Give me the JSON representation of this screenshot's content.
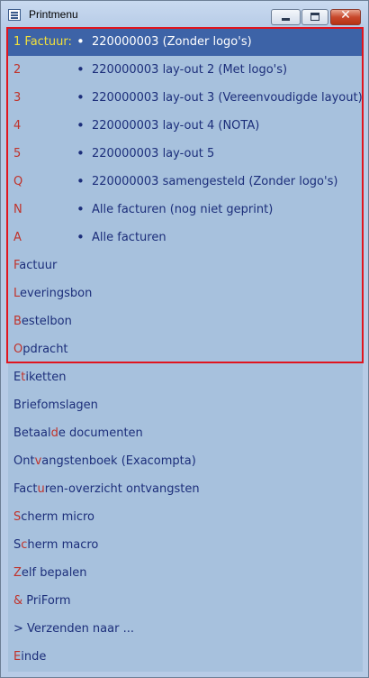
{
  "window": {
    "title": "Printmenu",
    "controls": {
      "minimize": "–",
      "maximize": "□",
      "close": "✕"
    }
  },
  "print_items": [
    {
      "key": "1",
      "key_suffix": " Factuur:",
      "bullet": "•",
      "text": "220000003 (Zonder logo's)",
      "selected": true
    },
    {
      "key": "2",
      "key_suffix": "",
      "bullet": "•",
      "text": "220000003 lay-out 2 (Met logo's)"
    },
    {
      "key": "3",
      "key_suffix": "",
      "bullet": "•",
      "text": "220000003 lay-out 3 (Vereenvoudigde layout)"
    },
    {
      "key": "4",
      "key_suffix": "",
      "bullet": "•",
      "text": "220000003 lay-out 4 (NOTA)"
    },
    {
      "key": "5",
      "key_suffix": "",
      "bullet": "•",
      "text": "220000003 lay-out 5"
    },
    {
      "key": "Q",
      "key_suffix": "",
      "bullet": "•",
      "text": "220000003 samengesteld (Zonder logo's)"
    },
    {
      "key": "N",
      "key_suffix": "",
      "bullet": "•",
      "text": "Alle facturen (nog niet geprint)"
    },
    {
      "key": "A",
      "key_suffix": "",
      "bullet": "•",
      "text": "Alle facturen"
    }
  ],
  "menu_items": [
    {
      "pre": "",
      "hotkey": "F",
      "rest": "actuur"
    },
    {
      "pre": "",
      "hotkey": "L",
      "rest": "everingsbon"
    },
    {
      "pre": "",
      "hotkey": "B",
      "rest": "estelbon"
    },
    {
      "pre": "",
      "hotkey": "O",
      "rest": "pdracht"
    },
    {
      "pre": "E",
      "hotkey": "t",
      "rest": "iketten"
    },
    {
      "pre": "",
      "hotkey": "",
      "rest": "Briefomslagen"
    },
    {
      "pre": "Betaal",
      "hotkey": "d",
      "rest": "e documenten"
    },
    {
      "pre": "Ont",
      "hotkey": "v",
      "rest": "angstenboek (Exacompta)"
    },
    {
      "pre": "Fact",
      "hotkey": "u",
      "rest": "ren-overzicht ontvangsten"
    },
    {
      "pre": "",
      "hotkey": "S",
      "rest": "cherm micro"
    },
    {
      "pre": "S",
      "hotkey": "c",
      "rest": "herm macro"
    },
    {
      "pre": "",
      "hotkey": "Z",
      "rest": "elf bepalen"
    },
    {
      "pre": "",
      "hotkey": "&",
      "rest": " PriForm"
    },
    {
      "pre": "",
      "hotkey": "",
      "rest": "> Verzenden naar ..."
    },
    {
      "pre": "",
      "hotkey": "E",
      "rest": "inde"
    }
  ],
  "colors": {
    "selection": "#3d63a7",
    "hotkey": "#c0322a",
    "text": "#1c2e7a",
    "highlight_border": "#e0141e"
  }
}
